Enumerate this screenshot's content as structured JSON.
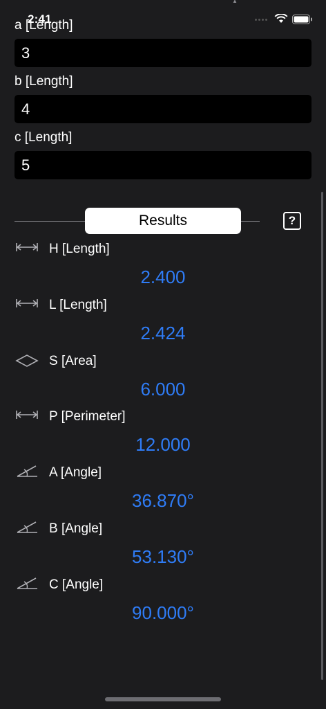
{
  "status_bar": {
    "time": "2:41"
  },
  "inputs": [
    {
      "label": "a [Length]",
      "value": "3"
    },
    {
      "label": "b [Length]",
      "value": "4"
    },
    {
      "label": "c [Length]",
      "value": "5"
    }
  ],
  "results_header": {
    "title": "Results",
    "help_label": "?"
  },
  "results": [
    {
      "icon": "length-icon",
      "label": "H [Length]",
      "value": "2.400"
    },
    {
      "icon": "length-icon",
      "label": "L [Length]",
      "value": "2.424"
    },
    {
      "icon": "area-icon",
      "label": "S [Area]",
      "value": "6.000"
    },
    {
      "icon": "perimeter-icon",
      "label": "P [Perimeter]",
      "value": "12.000"
    },
    {
      "icon": "angle-icon",
      "label": "A [Angle]",
      "value": "36.870°"
    },
    {
      "icon": "angle-icon",
      "label": "B [Angle]",
      "value": "53.130°"
    },
    {
      "icon": "angle-icon",
      "label": "C [Angle]",
      "value": "90.000°"
    }
  ],
  "colors": {
    "background": "#1c1c1e",
    "input_background": "#000000",
    "value_text": "#2f7cf6",
    "pill_background": "#ffffff"
  }
}
